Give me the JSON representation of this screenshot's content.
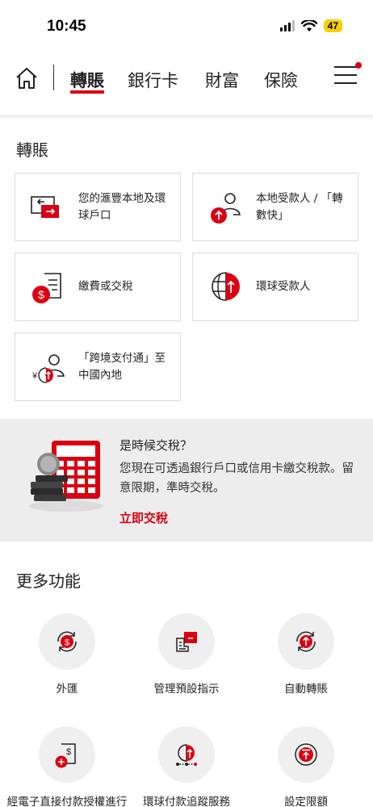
{
  "status_bar": {
    "time": "10:45",
    "battery": "47"
  },
  "nav": {
    "tabs": [
      {
        "label": "轉賬"
      },
      {
        "label": "銀行卡"
      },
      {
        "label": "財富"
      },
      {
        "label": "保險"
      }
    ]
  },
  "transfer": {
    "title": "轉賬",
    "cards": [
      {
        "label": "您的滙豐本地及環球戶口",
        "icon": "account-transfer-icon"
      },
      {
        "label": "本地受款人 / 「轉數快」",
        "icon": "local-payee-icon"
      },
      {
        "label": "繳費或交稅",
        "icon": "bill-payment-icon"
      },
      {
        "label": "環球受款人",
        "icon": "global-payee-icon"
      },
      {
        "label": "「跨境支付通」至中國內地",
        "icon": "cross-boundary-icon"
      }
    ]
  },
  "promo": {
    "title": "是時候交稅？",
    "body": "您現在可透過銀行戶口或信用卡繳交稅款。留意限期，準時交稅。",
    "link": "立即交稅"
  },
  "more": {
    "title": "更多功能",
    "items": [
      {
        "label": "外匯",
        "icon": "fx-icon"
      },
      {
        "label": "管理預設指示",
        "icon": "standing-instruction-icon"
      },
      {
        "label": "自動轉賬",
        "icon": "auto-transfer-icon"
      },
      {
        "label": "經電子直接付款授權進行繳費戶口",
        "icon": "edda-icon"
      },
      {
        "label": "環球付款追蹤服務",
        "icon": "payment-tracker-icon"
      },
      {
        "label": "設定限額",
        "icon": "set-limit-icon"
      }
    ]
  },
  "colors": {
    "accent": "#db0011",
    "promo_bg": "#ededed"
  }
}
